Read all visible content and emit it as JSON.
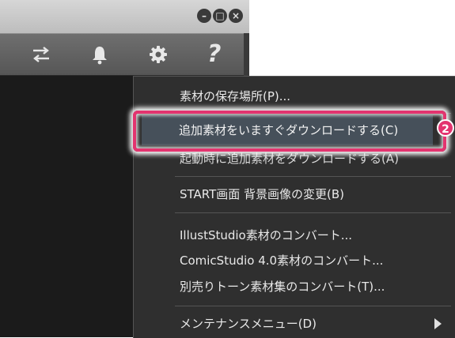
{
  "window": {
    "buttons": [
      "minimize",
      "maximize",
      "close"
    ]
  },
  "toolbar": {
    "icons": [
      "swap-icon",
      "bell-icon",
      "gear-icon",
      "help-icon"
    ],
    "help_label": "?"
  },
  "menu": {
    "items": [
      {
        "label": "素材の保存場所(P)..."
      },
      {
        "label": "追加素材をいますぐダウンロードする(C)"
      },
      {
        "label": "起動時に追加素材をダウンロードする(A)"
      },
      {
        "label": "START画面 背景画像の変更(B)"
      },
      {
        "label": "IllustStudio素材のコンバート..."
      },
      {
        "label": "ComicStudio 4.0素材のコンバート..."
      },
      {
        "label": "別売りトーン素材集のコンバート(T)..."
      },
      {
        "label": "メンテナンスメニュー(D)"
      }
    ]
  },
  "callout": {
    "badge": "2",
    "color": "#e3346f"
  },
  "colors": {
    "menu_bg": "#2f2f2f",
    "highlight_bg": "#46505a",
    "titlebar_bg": "#c8c8c8",
    "toolbar_bg": "#626262"
  }
}
